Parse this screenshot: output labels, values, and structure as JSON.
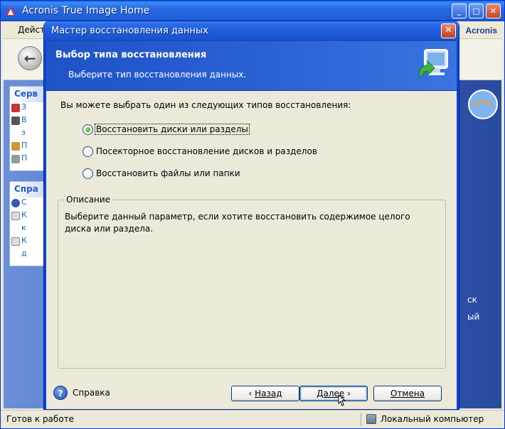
{
  "app": {
    "title": "Acronis True Image Home",
    "menu_item": "Дейст",
    "logo": "Acronis",
    "panels": [
      {
        "header": "Серв",
        "items": [
          {
            "label": "З",
            "color": "#c33"
          },
          {
            "label": "В",
            "color": "#555"
          },
          {
            "label": "з",
            "color": "#fff"
          },
          {
            "label": "П",
            "color": "#c93"
          },
          {
            "label": "П",
            "color": "#999"
          }
        ]
      },
      {
        "header": "Спра",
        "items": [
          {
            "label": "С",
            "color": "#3557b8"
          },
          {
            "label": "К",
            "color": "#ddd"
          },
          {
            "label": "к",
            "color": "#fff"
          },
          {
            "label": "К",
            "color": "#ddd"
          },
          {
            "label": "д",
            "color": "#fff"
          }
        ]
      }
    ],
    "right_text_1": "ск",
    "right_text_2": "ый",
    "status_left": "Готов к работе",
    "status_right": "Локальный компьютер"
  },
  "dialog": {
    "title": "Мастер восстановления данных",
    "header_title": "Выбор типа восстановления",
    "header_subtitle": "Выберите тип восстановления данных.",
    "intro": "Вы можете выбрать один из следующих типов восстановления:",
    "options": [
      {
        "label": "Восстановить диски или разделы",
        "checked": true
      },
      {
        "label": "Посекторное восстановление дисков и разделов",
        "checked": false
      },
      {
        "label": "Восстановить файлы или папки",
        "checked": false
      }
    ],
    "group_title": "Описание",
    "description": "Выберите данный параметр, если хотите восстановить содержимое целого диска или раздела.",
    "help_label": "Справка",
    "back_label": "Назад",
    "next_label": "Далее",
    "cancel_label": "Отмена"
  },
  "icons": {
    "app": "acronis-app-icon",
    "header": "monitor-restore-icon",
    "help": "question-icon",
    "back": "back-arrow-icon"
  },
  "colors": {
    "titlebar": "#1f5dd9",
    "dialog_header": "#2960d4",
    "face": "#ece9d8",
    "radio_check": "#21a121"
  }
}
